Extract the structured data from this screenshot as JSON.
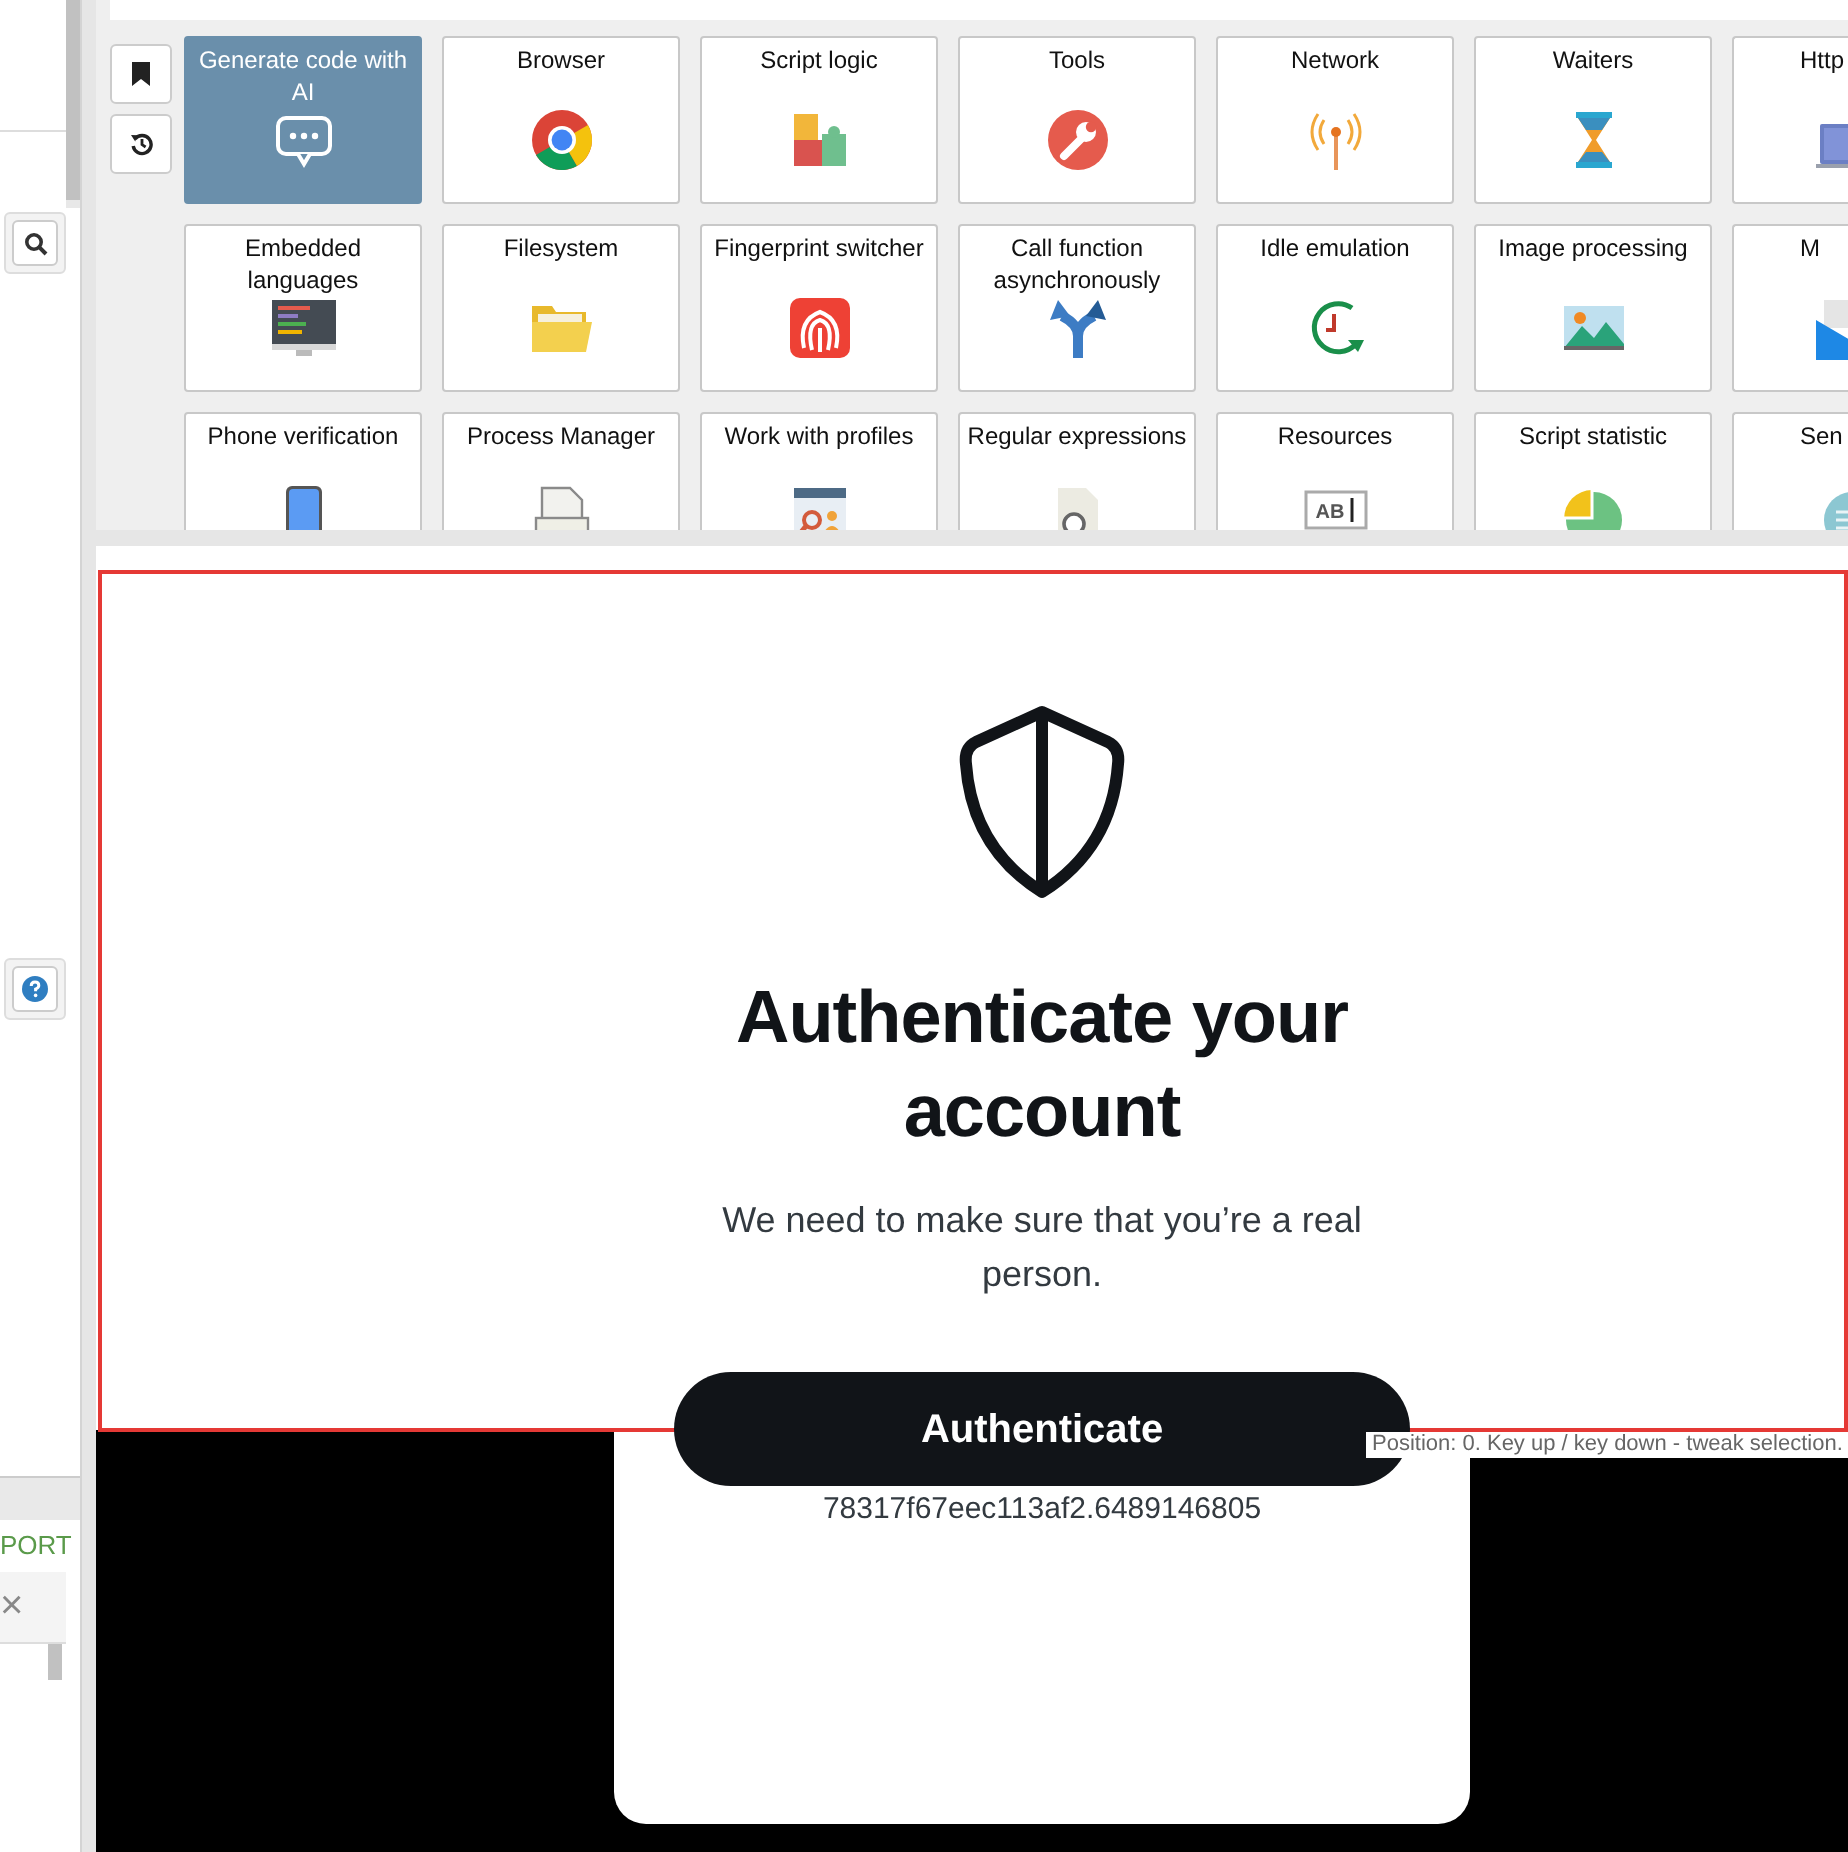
{
  "left_panel": {
    "export_tab": "PORT",
    "close_glyph": "×"
  },
  "tiles": [
    {
      "label": "Generate code with AI",
      "kind": "chat",
      "selected": true
    },
    {
      "label": "Browser",
      "kind": "chrome",
      "selected": false
    },
    {
      "label": "Script logic",
      "kind": "puzzle",
      "selected": false
    },
    {
      "label": "Tools",
      "kind": "wrench",
      "selected": false
    },
    {
      "label": "Network",
      "kind": "antenna",
      "selected": false
    },
    {
      "label": "Waiters",
      "kind": "hourglass",
      "selected": false
    },
    {
      "label": "Http",
      "kind": "http",
      "selected": false
    },
    {
      "label": "Embedded languages",
      "kind": "code",
      "selected": false
    },
    {
      "label": "Filesystem",
      "kind": "folder",
      "selected": false
    },
    {
      "label": "Fingerprint switcher",
      "kind": "fingerprint",
      "selected": false
    },
    {
      "label": "Call function asynchronously",
      "kind": "fork",
      "selected": false
    },
    {
      "label": "Idle emulation",
      "kind": "clock",
      "selected": false
    },
    {
      "label": "Image processing",
      "kind": "image",
      "selected": false
    },
    {
      "label": "M",
      "kind": "mail",
      "selected": false
    },
    {
      "label": "Phone verification",
      "kind": "phone",
      "selected": false
    },
    {
      "label": "Process Manager",
      "kind": "exe",
      "selected": false
    },
    {
      "label": "Work with profiles",
      "kind": "profiles",
      "selected": false
    },
    {
      "label": "Regular expressions",
      "kind": "regex",
      "selected": false
    },
    {
      "label": "Resources",
      "kind": "textbox",
      "selected": false,
      "icon_text": "AB"
    },
    {
      "label": "Script statistic",
      "kind": "pie",
      "selected": false
    },
    {
      "label": "Sen",
      "kind": "send",
      "selected": false
    }
  ],
  "page": {
    "heading": "Authenticate your account",
    "text": "We need to make sure that you’re a real person.",
    "button": "Authenticate",
    "token": "78317f67eec113af2.6489146805"
  },
  "tooltip": "Position: 0. Key up / key down - tweak selection."
}
